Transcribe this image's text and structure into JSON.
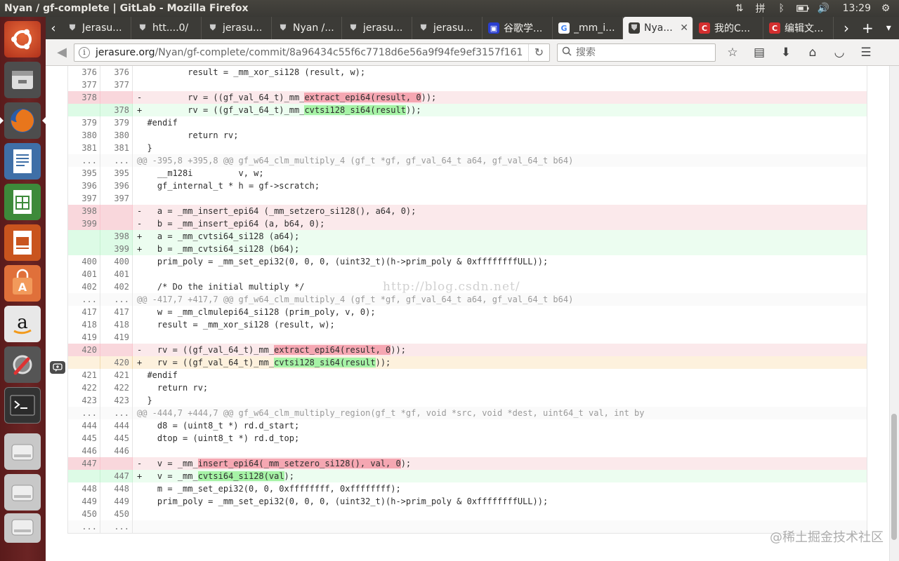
{
  "window": {
    "title": "Nyan / gf-complete | GitLab - Mozilla Firefox",
    "clock": "13:29"
  },
  "tabs": [
    {
      "label": "Jerasu...",
      "favicon": "gitlab-icon"
    },
    {
      "label": "htt....0/",
      "favicon": "gitlab-icon"
    },
    {
      "label": "jerasu...",
      "favicon": "gitlab-icon"
    },
    {
      "label": "Nyan /...",
      "favicon": "gitlab-icon"
    },
    {
      "label": "jerasu...",
      "favicon": "gitlab-icon"
    },
    {
      "label": "jerasu...",
      "favicon": "gitlab-icon"
    },
    {
      "label": "谷歌学...",
      "favicon": "scholar-icon"
    },
    {
      "label": "_mm_i...",
      "favicon": "google-icon"
    },
    {
      "label": "Nya...",
      "favicon": "gitlab-icon",
      "active": true
    },
    {
      "label": "我的C...",
      "favicon": "csdn-icon"
    },
    {
      "label": "编辑文...",
      "favicon": "csdn-icon"
    }
  ],
  "nav": {
    "url_host": "jerasure.org",
    "url_path": "/Nyan/gf-complete/commit/8a96434c55f6c7718d6e56a9f94fe9ef3157f161",
    "search_placeholder": "搜索"
  },
  "diff": {
    "rows": [
      {
        "type": "context",
        "old": "376",
        "new": "376",
        "code": "        result = _mm_xor_si128 (result, w);"
      },
      {
        "type": "context",
        "old": "377",
        "new": "377",
        "code": ""
      },
      {
        "type": "old",
        "old": "378",
        "new": "",
        "sign": "-",
        "pre": "        rv = ((gf_val_64_t)_mm_",
        "hl": "extract_epi64(result, 0",
        "post": "));"
      },
      {
        "type": "new",
        "old": "",
        "new": "378",
        "sign": "+",
        "pre": "        rv = ((gf_val_64_t)_mm_",
        "hl": "cvtsi128_si64(result",
        "post": "));"
      },
      {
        "type": "context",
        "old": "379",
        "new": "379",
        "code": "#endif"
      },
      {
        "type": "context",
        "old": "380",
        "new": "380",
        "code": "        return rv;"
      },
      {
        "type": "context",
        "old": "381",
        "new": "381",
        "code": "}"
      },
      {
        "type": "match",
        "old": "...",
        "new": "...",
        "code": "@@ -395,8 +395,8 @@ gf_w64_clm_multiply_4 (gf_t *gf, gf_val_64_t a64, gf_val_64_t b64)"
      },
      {
        "type": "context",
        "old": "395",
        "new": "395",
        "code": "  __m128i         v, w;"
      },
      {
        "type": "context",
        "old": "396",
        "new": "396",
        "code": "  gf_internal_t * h = gf->scratch;"
      },
      {
        "type": "context",
        "old": "397",
        "new": "397",
        "code": ""
      },
      {
        "type": "old",
        "old": "398",
        "new": "",
        "sign": "-",
        "pre": "  a = _mm_insert_epi64 (_mm_setzero_si128(), a64, 0);",
        "hl": "",
        "post": ""
      },
      {
        "type": "old",
        "old": "399",
        "new": "",
        "sign": "-",
        "pre": "  b = _mm_insert_epi64 (a, b64, 0);",
        "hl": "",
        "post": ""
      },
      {
        "type": "new",
        "old": "",
        "new": "398",
        "sign": "+",
        "pre": "  a = _mm_cvtsi64_si128 (a64);",
        "hl": "",
        "post": ""
      },
      {
        "type": "new",
        "old": "",
        "new": "399",
        "sign": "+",
        "pre": "  b = _mm_cvtsi64_si128 (b64);",
        "hl": "",
        "post": ""
      },
      {
        "type": "context",
        "old": "400",
        "new": "400",
        "code": "  prim_poly = _mm_set_epi32(0, 0, 0, (uint32_t)(h->prim_poly & 0xffffffffULL));"
      },
      {
        "type": "context",
        "old": "401",
        "new": "401",
        "code": ""
      },
      {
        "type": "context",
        "old": "402",
        "new": "402",
        "code": "  /* Do the initial multiply */"
      },
      {
        "type": "match",
        "old": "...",
        "new": "...",
        "code": "@@ -417,7 +417,7 @@ gf_w64_clm_multiply_4 (gf_t *gf, gf_val_64_t a64, gf_val_64_t b64)"
      },
      {
        "type": "context",
        "old": "417",
        "new": "417",
        "code": "  w = _mm_clmulepi64_si128 (prim_poly, v, 0);"
      },
      {
        "type": "context",
        "old": "418",
        "new": "418",
        "code": "  result = _mm_xor_si128 (result, w);"
      },
      {
        "type": "context",
        "old": "419",
        "new": "419",
        "code": ""
      },
      {
        "type": "old",
        "old": "420",
        "new": "",
        "sign": "-",
        "pre": "  rv = ((gf_val_64_t)_mm_",
        "hl": "extract_epi64(result, 0",
        "post": "));"
      },
      {
        "type": "new",
        "highlight": true,
        "old": "",
        "new": "420",
        "sign": "+",
        "pre": "  rv = ((gf_val_64_t)_mm_",
        "hl": "cvtsi128_si64(result",
        "post": "));"
      },
      {
        "type": "context",
        "old": "421",
        "new": "421",
        "code": "#endif"
      },
      {
        "type": "context",
        "old": "422",
        "new": "422",
        "code": "  return rv;"
      },
      {
        "type": "context",
        "old": "423",
        "new": "423",
        "code": "}"
      },
      {
        "type": "match",
        "old": "...",
        "new": "...",
        "code": "@@ -444,7 +444,7 @@ gf_w64_clm_multiply_region(gf_t *gf, void *src, void *dest, uint64_t val, int by"
      },
      {
        "type": "context",
        "old": "444",
        "new": "444",
        "code": "  d8 = (uint8_t *) rd.d_start;"
      },
      {
        "type": "context",
        "old": "445",
        "new": "445",
        "code": "  dtop = (uint8_t *) rd.d_top;"
      },
      {
        "type": "context",
        "old": "446",
        "new": "446",
        "code": ""
      },
      {
        "type": "old",
        "old": "447",
        "new": "",
        "sign": "-",
        "pre": "  v = _mm_",
        "hl": "insert_epi64(_mm_setzero_si128(), val, 0",
        "post": ");"
      },
      {
        "type": "new",
        "old": "",
        "new": "447",
        "sign": "+",
        "pre": "  v = _mm_",
        "hl": "cvtsi64_si128(val",
        "post": ");"
      },
      {
        "type": "context",
        "old": "448",
        "new": "448",
        "code": "  m = _mm_set_epi32(0, 0, 0xffffffff, 0xffffffff);"
      },
      {
        "type": "context",
        "old": "449",
        "new": "449",
        "code": "  prim_poly = _mm_set_epi32(0, 0, 0, (uint32_t)(h->prim_poly & 0xffffffffULL));"
      },
      {
        "type": "context",
        "old": "450",
        "new": "450",
        "code": ""
      },
      {
        "type": "match",
        "old": "...",
        "new": "...",
        "code": ""
      }
    ]
  },
  "watermarks": {
    "center": "http://blog.csdn.net/",
    "corner": "@稀土掘金技术社区"
  }
}
